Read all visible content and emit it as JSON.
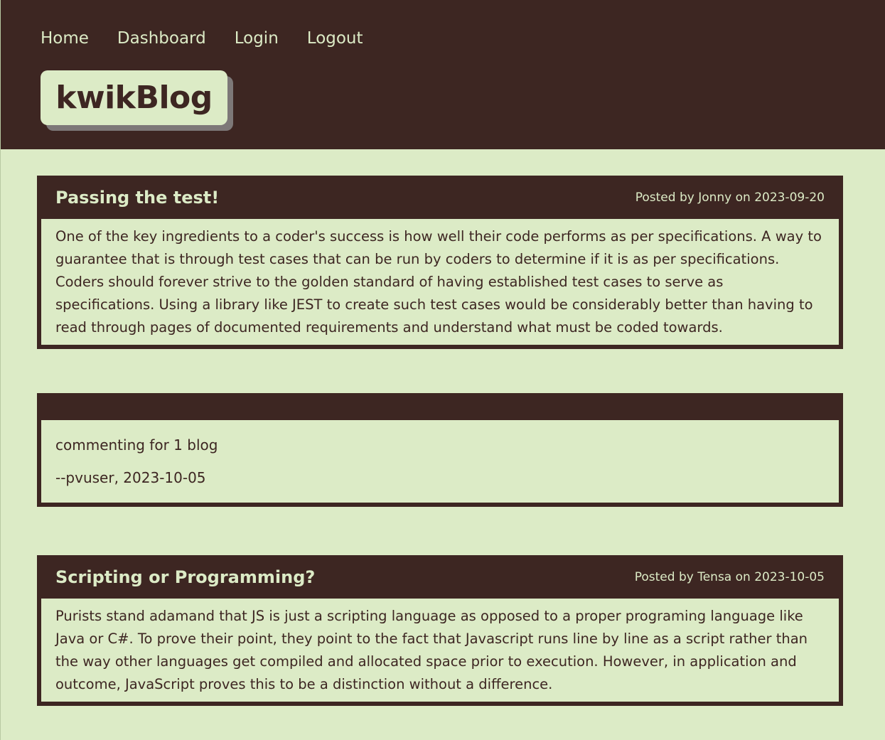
{
  "nav": {
    "items": [
      {
        "label": "Home"
      },
      {
        "label": "Dashboard"
      },
      {
        "label": "Login"
      },
      {
        "label": "Logout"
      }
    ]
  },
  "brand": {
    "title": "kwikBlog"
  },
  "posts": [
    {
      "title": "Passing the test!",
      "meta": "Posted by Jonny on 2023-09-20",
      "body": "One of the key ingredients to a coder's success is how well their code performs as per specifications. A way to guarantee that is through test cases that can be run by coders to determine if it is as per specifications. Coders should forever strive to the golden standard of having established test cases to serve as specifications. Using a library like JEST to create such test cases would be considerably better than having to read through pages of documented requirements and understand what must be coded towards."
    },
    {
      "title": "Scripting or Programming?",
      "meta": "Posted by Tensa on 2023-10-05",
      "body": "Purists stand adamand that JS is just a scripting language as opposed to a proper programing language like Java or C#. To prove their point, they point to the fact that Javascript runs line by line as a script rather than the way other languages get compiled and allocated space prior to execution. However, in application and outcome, JavaScript proves this to be a distinction without a difference."
    }
  ],
  "comment": {
    "text": "commenting for 1 blog",
    "signature": "--pvuser, 2023-10-05"
  },
  "colors": {
    "header_bg": "#3d2622",
    "page_bg": "#dcebc6",
    "brand_shadow": "#7d7878"
  }
}
